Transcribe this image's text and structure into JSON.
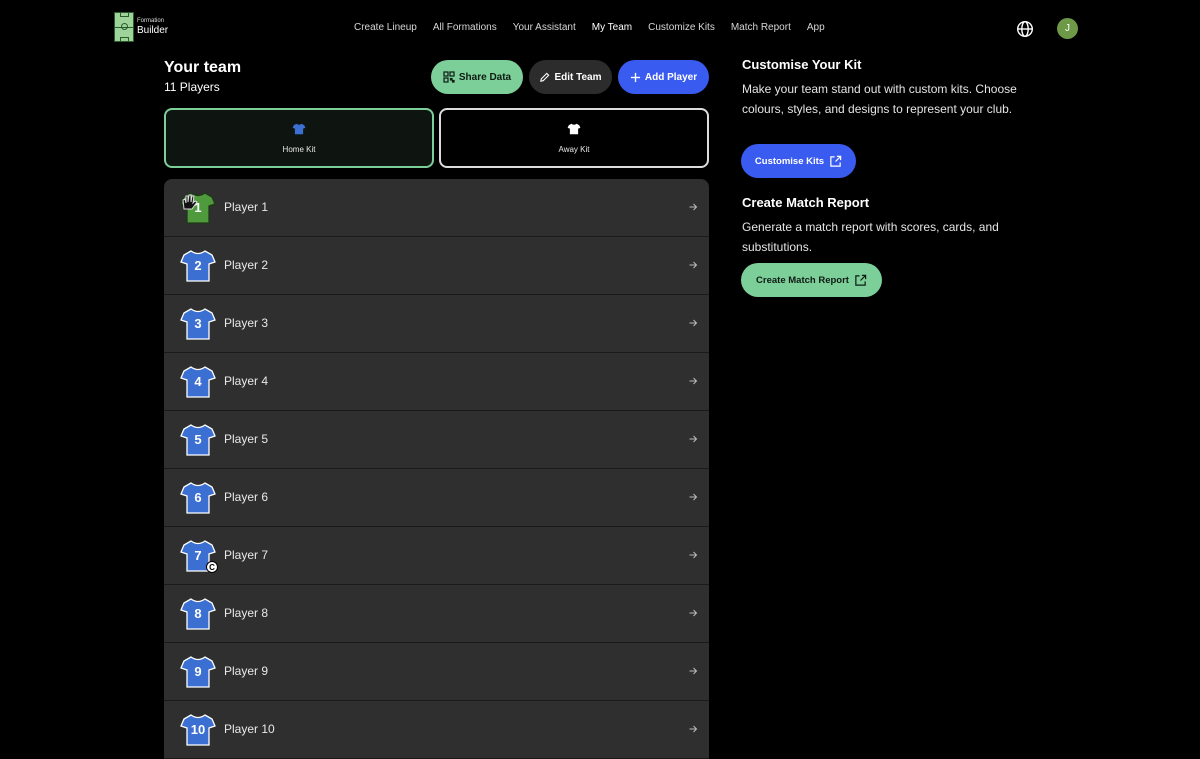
{
  "brand": {
    "small": "Formation",
    "big": "Builder"
  },
  "nav": {
    "links": [
      "Create Lineup",
      "All Formations",
      "Your Assistant",
      "My Team",
      "Customize Kits",
      "Match Report",
      "App"
    ],
    "active": "My Team",
    "avatar_initial": "J"
  },
  "team": {
    "title": "Your team",
    "count": "11 Players",
    "share_label": "Share Data",
    "edit_label": "Edit Team",
    "add_label": "Add Player"
  },
  "kits": {
    "home_label": "Home Kit",
    "away_label": "Away Kit",
    "home_color": "#3b6fd1",
    "away_color": "#ffffff"
  },
  "players": [
    {
      "number": "1",
      "name": "Player 1",
      "kit": "goalkeeper",
      "captain": false
    },
    {
      "number": "2",
      "name": "Player 2",
      "kit": "outfield",
      "captain": false
    },
    {
      "number": "3",
      "name": "Player 3",
      "kit": "outfield",
      "captain": false
    },
    {
      "number": "4",
      "name": "Player 4",
      "kit": "outfield",
      "captain": false
    },
    {
      "number": "5",
      "name": "Player 5",
      "kit": "outfield",
      "captain": false
    },
    {
      "number": "6",
      "name": "Player 6",
      "kit": "outfield",
      "captain": false
    },
    {
      "number": "7",
      "name": "Player 7",
      "kit": "outfield",
      "captain": true
    },
    {
      "number": "8",
      "name": "Player 8",
      "kit": "outfield",
      "captain": false
    },
    {
      "number": "9",
      "name": "Player 9",
      "kit": "outfield",
      "captain": false
    },
    {
      "number": "10",
      "name": "Player 10",
      "kit": "outfield",
      "captain": false
    }
  ],
  "captain_mark": "C",
  "customise": {
    "title": "Customise Your Kit",
    "body": "Make your team stand out with custom kits. Choose colours, styles, and designs to represent your club.",
    "button": "Customise Kits"
  },
  "report": {
    "title": "Create Match Report",
    "body": "Generate a match report with scores, cards, and substitutions.",
    "button": "Create Match Report"
  },
  "colors": {
    "accent_green": "#7dcf9a",
    "accent_blue": "#3a5bf0",
    "goalkeeper_shirt": "#4e9a3d",
    "outfield_shirt": "#3b6fd1"
  }
}
